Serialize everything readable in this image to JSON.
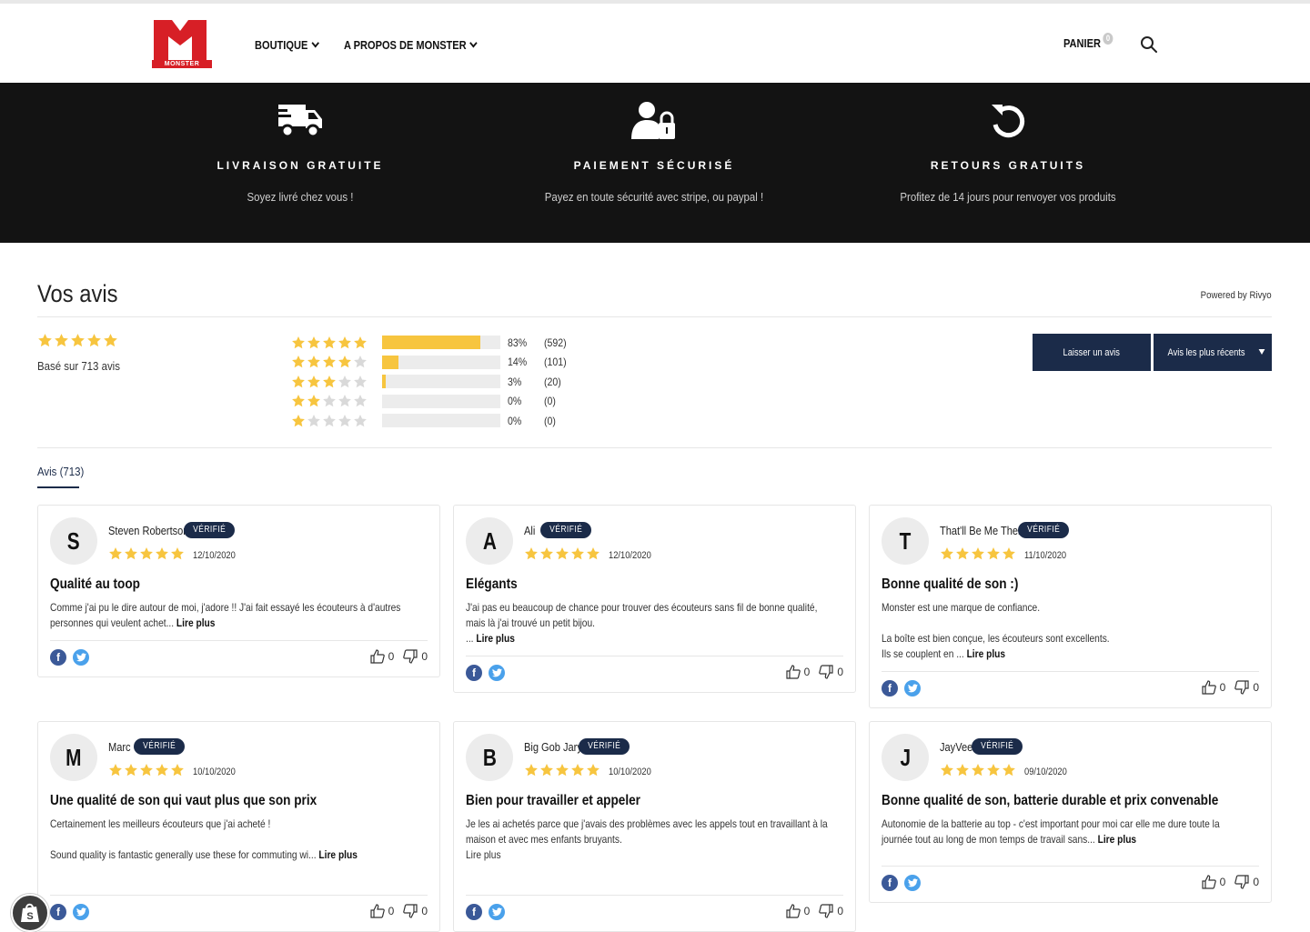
{
  "brand": {
    "logo_text": "MONSTER",
    "logo_color": "#d71f26"
  },
  "nav": {
    "items": [
      {
        "label": "BOUTIQUE"
      },
      {
        "label": "A PROPOS DE MONSTER"
      }
    ]
  },
  "cart": {
    "label": "PANIER",
    "count": "0"
  },
  "features": [
    {
      "icon": "truck-icon",
      "title": "LIVRAISON GRATUITE",
      "subtitle": "Soyez livré chez vous !"
    },
    {
      "icon": "secure-user-lock-icon",
      "title": "PAIEMENT SÉCURISÉ",
      "subtitle": "Payez en toute sécurité avec stripe, ou paypal !"
    },
    {
      "icon": "return-arrow-icon",
      "title": "RETOURS GRATUITS",
      "subtitle": "Profitez de 14 jours pour renvoyer vos produits"
    }
  ],
  "reviews": {
    "title": "Vos avis",
    "powered_by": "Powered by Rivyo",
    "average_rating": 5,
    "based_on": "Basé sur 713 avis",
    "histogram": [
      {
        "stars": 5,
        "fill": 0.83,
        "percent": "83%",
        "count": "(592)"
      },
      {
        "stars": 4,
        "fill": 0.14,
        "percent": "14%",
        "count": "(101)"
      },
      {
        "stars": 3,
        "fill": 0.03,
        "percent": "3%",
        "count": "(20)"
      },
      {
        "stars": 2,
        "fill": 0.0,
        "percent": "0%",
        "count": "(0)"
      },
      {
        "stars": 1,
        "fill": 0.0,
        "percent": "0%",
        "count": "(0)"
      }
    ],
    "write_button": "Laisser un avis",
    "sort_button": "Avis les plus récents",
    "tab_label": "Avis (713)",
    "verified_label": "VÉRIFIÉ",
    "read_more": "Lire plus",
    "items": [
      {
        "initial": "S",
        "name": "Steven Robertson",
        "rating": 5,
        "date": "12/10/2020",
        "title": "Qualité au toop",
        "body": [
          "Comme j'ai pu le dire autour de moi, j'adore !! J'ai fait essayé les écouteurs à d'autres personnes qui veulent achet..."
        ],
        "likes": "0",
        "dislikes": "0"
      },
      {
        "initial": "A",
        "name": "Ali",
        "rating": 5,
        "date": "12/10/2020",
        "title": "Elégants",
        "body": [
          "J'ai pas eu beaucoup de chance pour trouver des écouteurs sans fil de bonne qualité, mais là j'ai trouvé un petit bijou.",
          "..."
        ],
        "likes": "0",
        "dislikes": "0"
      },
      {
        "initial": "T",
        "name": "That'll Be Me Then",
        "rating": 5,
        "date": "11/10/2020",
        "title": "Bonne qualité de son :)",
        "body": [
          "Monster est une marque de confiance.",
          "",
          "La boîte est bien conçue, les écouteurs sont excellents.",
          "Ils se couplent en ..."
        ],
        "likes": "0",
        "dislikes": "0"
      },
      {
        "initial": "M",
        "name": "Marc",
        "rating": 5,
        "date": "10/10/2020",
        "title": "Une qualité de son qui vaut plus que son prix",
        "body": [
          "Certainement les meilleurs écouteurs que j'ai acheté !",
          "",
          "Sound quality is fantastic generally use these for commuting wi..."
        ],
        "likes": "0",
        "dislikes": "0"
      },
      {
        "initial": "B",
        "name": "Big Gob Jary",
        "rating": 5,
        "date": "10/10/2020",
        "title": "Bien pour travailler et appeler",
        "body": [
          "Je les ai achetés parce que j'avais des problèmes avec les appels tout en travaillant à la maison et avec mes enfants bruyants.",
          "Lire plus"
        ],
        "likes": "0",
        "dislikes": "0"
      },
      {
        "initial": "J",
        "name": "JayVee",
        "rating": 5,
        "date": "09/10/2020",
        "title": "Bonne qualité de son, batterie durable et prix convenable",
        "body": [
          "Autonomie de la batterie au top - c'est important pour moi car elle me dure toute la journée tout au long de mon temps de travail sans..."
        ],
        "likes": "0",
        "dislikes": "0"
      }
    ]
  },
  "colors": {
    "star": "#f7c53f",
    "star_empty": "#d9d9d9",
    "navy": "#1b2b49",
    "banner": "#131313"
  }
}
